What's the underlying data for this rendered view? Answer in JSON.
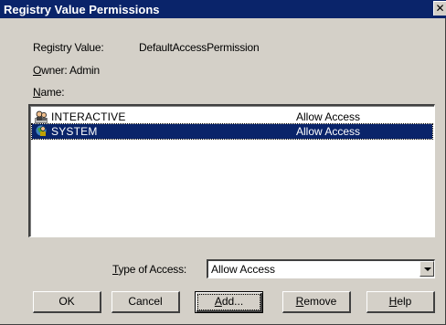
{
  "window": {
    "title": "Registry Value Permissions",
    "close_glyph": "✕"
  },
  "info": {
    "registry_value_label": "Registry Value:",
    "registry_value": "DefaultAccessPermission",
    "owner_label_prefix": "O",
    "owner_label_rest": "wner: ",
    "owner_value": "Admin",
    "name_label_prefix": "N",
    "name_label_rest": "ame:"
  },
  "list": {
    "items": [
      {
        "name": "INTERACTIVE",
        "access": "Allow Access",
        "icon": "user-group-icon",
        "selected": false
      },
      {
        "name": "SYSTEM",
        "access": "Allow Access",
        "icon": "system-user-icon",
        "selected": true
      }
    ]
  },
  "type_of_access": {
    "label_prefix": "T",
    "label_rest": "ype of Access:",
    "value": "Allow Access"
  },
  "buttons": {
    "ok": "OK",
    "cancel": "Cancel",
    "add_prefix": "A",
    "add_rest": "dd...",
    "remove_prefix": "R",
    "remove_rest": "emove",
    "help_prefix": "H",
    "help_rest": "elp"
  },
  "colors": {
    "titlebar": "#0a246a",
    "face": "#d4d0c8",
    "selection": "#0a246a"
  }
}
